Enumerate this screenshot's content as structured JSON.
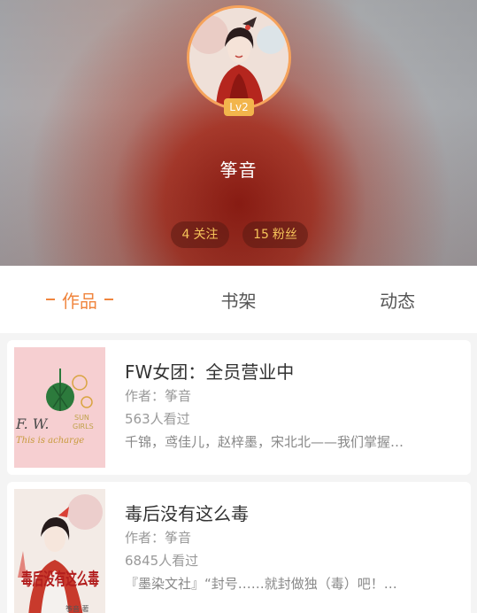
{
  "profile": {
    "level": "Lv2",
    "name": "筝音",
    "follow_count": "4",
    "follow_label": "关注",
    "fans_count": "15",
    "fans_label": "粉丝"
  },
  "tabs": [
    {
      "label": "作品",
      "active": true
    },
    {
      "label": "书架",
      "active": false
    },
    {
      "label": "动态",
      "active": false
    }
  ],
  "books": [
    {
      "title": "FW女团：全员营业中",
      "author": "作者：筝音",
      "views": "563人看过",
      "description": "千锦，鸢佳儿，赵梓墨，宋北北——我们掌握…",
      "cover_text": "F. W.",
      "cover_subtext": "This is acharge",
      "cover_sun": "SUN",
      "cover_girls": "GIRLS"
    },
    {
      "title": "毒后没有这么毒",
      "author": "作者：筝音",
      "views": "6845人看过",
      "description": "『墨染文社』“封号……就封做独（毒）吧！…",
      "cover_title": "毒后没有这么毒",
      "cover_author": "筝音 著"
    }
  ],
  "colors": {
    "accent": "#f0853e",
    "level_badge": "#f2b54c",
    "stat_text": "#f6c45a"
  }
}
